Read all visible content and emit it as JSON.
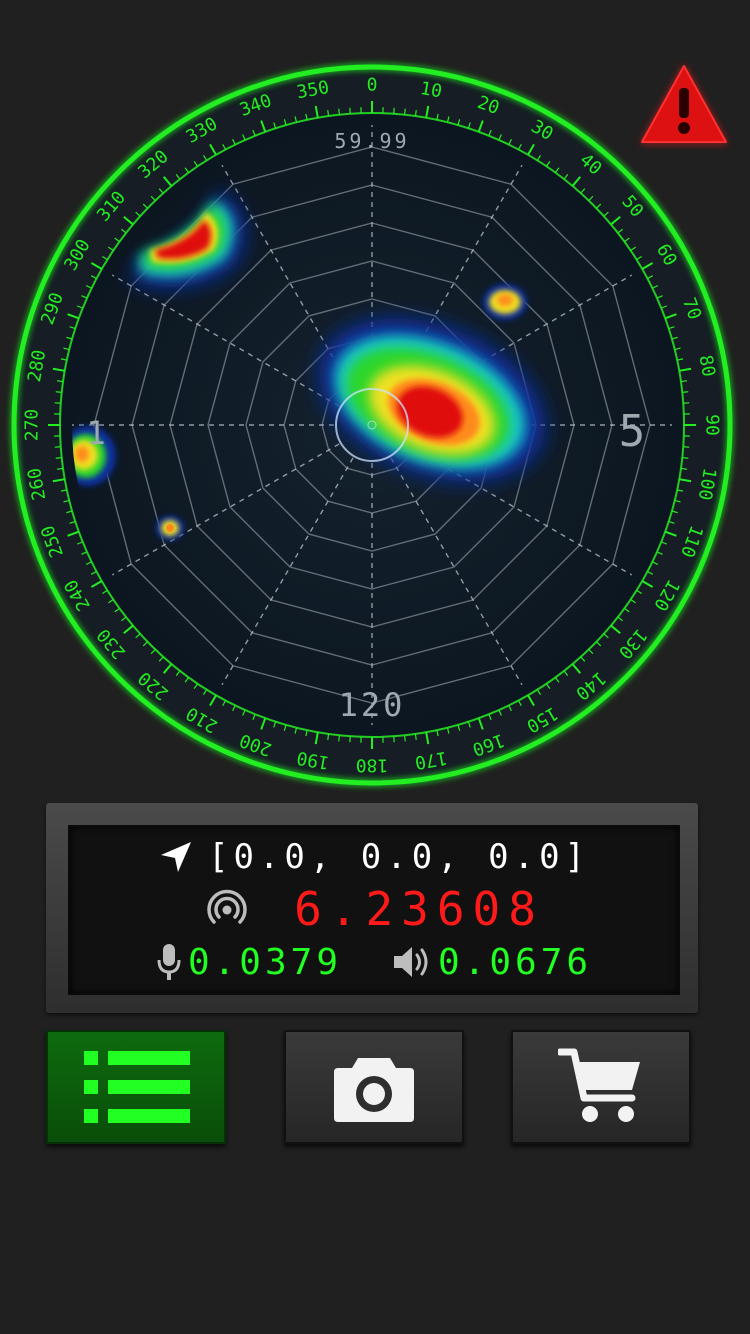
{
  "radar": {
    "top_value": "59.99",
    "bottom_value": "120",
    "left_marker": "1",
    "right_marker": "5",
    "bearing_labels": [
      "0",
      "10",
      "20",
      "30",
      "40",
      "50",
      "60",
      "70",
      "80",
      "90",
      "100",
      "110",
      "120",
      "130",
      "140",
      "150",
      "160",
      "170",
      "180",
      "190",
      "200",
      "210",
      "220",
      "230",
      "240",
      "250",
      "260",
      "270",
      "280",
      "290",
      "300",
      "310",
      "320",
      "330",
      "340",
      "350"
    ],
    "ring_color": "#22ee22",
    "background_color": "#0f1a24",
    "heat_colors": [
      "#0a2f9e",
      "#12c8c8",
      "#2bd62b",
      "#f0e020",
      "#ff8a1a",
      "#e01010"
    ],
    "hotspots_count": 5
  },
  "alert": {
    "icon": "warning-triangle-icon",
    "color": "#e01010"
  },
  "readout": {
    "location_icon": "location-arrow-icon",
    "coords": "[0.0, 0.0, 0.0]",
    "signal_icon": "signal-wave-icon",
    "signal_value": "6.23608",
    "signal_color": "#ff1a1a",
    "mic_icon": "microphone-icon",
    "mic_value": "0.0379",
    "speaker_icon": "speaker-icon",
    "speaker_value": "0.0676",
    "value_color": "#22ff22"
  },
  "buttons": {
    "list": {
      "icon": "list-icon",
      "active": true
    },
    "camera": {
      "icon": "camera-icon"
    },
    "cart": {
      "icon": "shopping-cart-icon"
    }
  }
}
